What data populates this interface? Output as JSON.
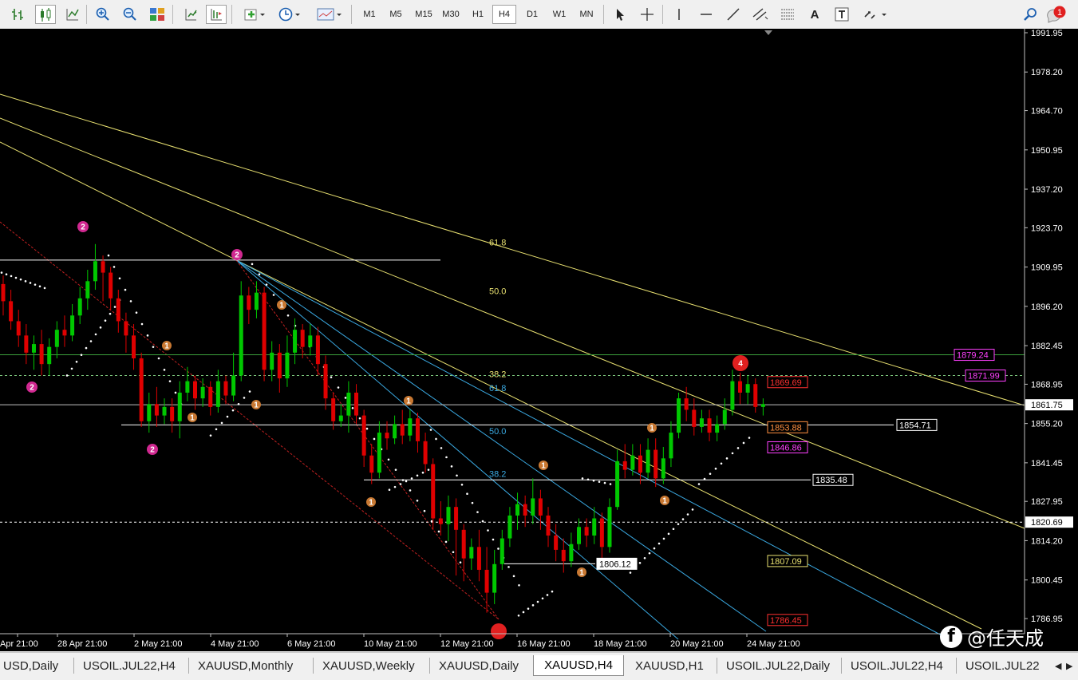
{
  "toolbar": {
    "timeframes": [
      "M1",
      "M5",
      "M15",
      "M30",
      "H1",
      "H4",
      "D1",
      "W1",
      "MN"
    ],
    "active_timeframe": "H4",
    "notification_count": "1",
    "text_tool_label": "A"
  },
  "chart": {
    "symbol": "XAUUSD",
    "timeframe": "H4",
    "price_axis_ticks": [
      "1991.95",
      "1978.20",
      "1964.70",
      "1950.95",
      "1937.20",
      "1923.70",
      "1909.95",
      "1896.20",
      "1882.45",
      "1868.95",
      "1855.20",
      "1841.45",
      "1827.95",
      "1814.20",
      "1800.45",
      "1786.95"
    ],
    "time_axis_ticks": [
      "Apr 21:00",
      "28 Apr 21:00",
      "2 May 21:00",
      "4 May 21:00",
      "6 May 21:00",
      "10 May 21:00",
      "12 May 21:00",
      "16 May 21:00",
      "18 May 21:00",
      "20 May 21:00",
      "24 May 21:00"
    ],
    "current_price": "1861.75",
    "price_labels": {
      "p1879": "1879.24",
      "p1871": "1871.99",
      "p1869": "1869.69",
      "p1853": "1853.88",
      "p1846": "1846.86",
      "p1854": "1854.71",
      "p1835": "1835.48",
      "p1820": "1820.69",
      "p1807": "1807.09",
      "p1806": "1806.12",
      "p1786": "1786.45"
    },
    "fib_levels_yellow": [
      "61.8",
      "50.0",
      "38.2"
    ],
    "fib_levels_blue": [
      "61.8",
      "50.0",
      "38.2"
    ],
    "wave_labels": {
      "red_4": "4",
      "magenta_2": "2",
      "orange_1": "1"
    }
  },
  "tabs": [
    {
      "label": "USD,Daily",
      "active": false
    },
    {
      "label": "USOIL.JUL22,H4",
      "active": false
    },
    {
      "label": "XAUUSD,Monthly",
      "active": false
    },
    {
      "label": "XAUUSD,Weekly",
      "active": false
    },
    {
      "label": "XAUUSD,Daily",
      "active": false
    },
    {
      "label": "XAUUSD,H4",
      "active": true
    },
    {
      "label": "XAUUSD,H1",
      "active": false
    },
    {
      "label": "USOIL.JUL22,Daily",
      "active": false
    },
    {
      "label": "USOIL.JUL22,H4",
      "active": false
    },
    {
      "label": "USOIL.JUL22",
      "active": false
    }
  ],
  "watermark": {
    "text": "@任天成",
    "logo": "f"
  },
  "colors": {
    "background": "#000000",
    "bull_candle": "#00c800",
    "bear_candle": "#e00000",
    "fib_yellow": "#e8e070",
    "fib_blue": "#3aa8e0",
    "channel_red": "#c02020",
    "label_magenta": "#ff40ff",
    "label_orange": "#ff9040",
    "label_red": "#ff3030",
    "wave_magenta": "#d02890",
    "wave_orange": "#c87832",
    "wave_red": "#e02020"
  }
}
